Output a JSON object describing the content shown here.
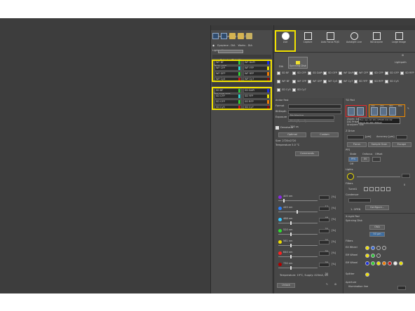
{
  "left_panel": {
    "title": "DC Fused (Spinning Disk) (1/2)",
    "section_lightpaths": "Lightpaths",
    "eyepiece": "Eyepiece - DIA",
    "works": "Works - DIA",
    "spinning_disk_label": "Spinning Disk (1)",
    "wf_section": "Wide Field",
    "sd_section": "Spinning Disc",
    "wf_rows": [
      {
        "left": "WF BF",
        "right": "WF DAPI",
        "lc": "#2fbf3a",
        "rc": "#1a2ee0"
      },
      {
        "left": "WF CFP",
        "right": "WF YFP",
        "lc": "#2fd0d0",
        "rc": "#e8e000"
      },
      {
        "left": "WF GFP",
        "right": "WF RFP",
        "lc": "#30d030",
        "rc": "#f07a00"
      },
      {
        "left": "WF Cy5",
        "right": "WF Cy7",
        "lc": "#c81818",
        "rc": "#8a0a0a"
      }
    ],
    "sd_rows": [
      {
        "left": "SD BF",
        "right": "SD DAPI",
        "lc": "#2fbf3a",
        "rc": "#1a2ee0"
      },
      {
        "left": "SD CFP",
        "right": "SD YFP",
        "lc": "#2fd0d0",
        "rc": "#e8e000"
      },
      {
        "left": "SD GFP",
        "right": "SD RFP",
        "lc": "#30d030",
        "rc": "#f07a00"
      },
      {
        "left": "SD Cy5",
        "right": "SD Cy7",
        "lc": "#c81818",
        "rc": "#8a0a0a"
      }
    ]
  },
  "right_panel": {
    "title": "Acquisition",
    "ribbon": [
      {
        "label": "Live",
        "icon": "play-icon"
      },
      {
        "label": "Capture",
        "icon": "camera-icon"
      },
      {
        "label": "Auto Focus PDJO",
        "icon": "autofocus-icon"
      },
      {
        "label": "Autolight Live",
        "icon": "sun-icon"
      },
      {
        "label": "ND Acquire",
        "icon": "nd-icon"
      },
      {
        "label": "Large Image",
        "icon": "grid-icon"
      }
    ],
    "lightpath_label": "Lightpath",
    "tabs": [
      {
        "label": "DIA"
      },
      {
        "label": "Spinning Disk"
      }
    ],
    "checks_row1": [
      "SD BF",
      "SD CFP",
      "SD DAPI",
      "SD GFP",
      "WF DAPI",
      "WF CFP",
      "SD CFP",
      "SD GFP",
      "SD RFP"
    ],
    "checks_row2": [
      "WF BF",
      "WF CFP",
      "WF GFP",
      "WF Cy5",
      "WF Cy7",
      "SD YFP",
      "SD RFP",
      "SD Cy5"
    ],
    "checks_row3": [
      "SD Cy5",
      "SD Cy7"
    ],
    "camera": {
      "header": "Andor Fast",
      "format_label": "Format",
      "format_value": "No binning",
      "bitdepth_label": "BitDepth",
      "bitdepth_value": "8 bit (Speed)",
      "exposure_label": "Exposure",
      "exposure_value": "700 us",
      "denoise_label": "Denoise.ai",
      "optimal": "Optimal",
      "custom": "Custom",
      "size_label": "Size: 2720x2720",
      "temp_label": "Temperature 5.0 °C",
      "commands": "Commands"
    },
    "lasers": [
      {
        "name": "405 nm",
        "value": "12",
        "unit": "[%]",
        "color": "#8a2be2",
        "level": 0.12
      },
      {
        "name": "445 nm",
        "value": "46",
        "unit": "[%]",
        "color": "#2a7fff",
        "level": 0.46
      },
      {
        "name": "488 nm",
        "value": "30",
        "unit": "[%]",
        "color": "#36c8ff",
        "level": 0.3
      },
      {
        "name": "520 nm",
        "value": "30",
        "unit": "[%]",
        "color": "#30e030",
        "level": 0.3
      },
      {
        "name": "561 nm",
        "value": "30",
        "unit": "[%]",
        "color": "#f0e000",
        "level": 0.3
      },
      {
        "name": "640 nm",
        "value": "30",
        "unit": "[%]",
        "color": "#ff2020",
        "level": 0.3
      },
      {
        "name": "730 nm",
        "value": "30",
        "unit": "[%]",
        "color": "#b00000",
        "level": 0.3
      }
    ],
    "laser_temp": "Temperature: 19°C, Supply: 420mA, SN",
    "unlock": "Unlock",
    "objective": {
      "header": "Ti2 Pad",
      "info_line1": "Zoom: 1x",
      "info_line2": "DIC Prism: -",
      "info_line3": "Analyzer: Out",
      "tooltip_line1": "Plan Apo λD 20x OFN25 DIC N2",
      "tooltip_line2": "NA=0.80 WD=800µm",
      "labels": [
        "10x",
        "20x",
        "40x",
        "60x"
      ]
    },
    "zdrive": {
      "header": "Z Drive",
      "value": "4094.380",
      "unit": "[µm]",
      "accuracy_label": "Accuracy [µm]",
      "accuracy_value": "0.000",
      "focus": "Focus",
      "sample_scan": "Sample Scan",
      "escape": "Escape"
    },
    "pfs": {
      "header": "PFS",
      "state": "State",
      "onfocus": "Onfocus",
      "offset": "Offset",
      "pfs_btn": "PFS",
      "in_btn": "IN",
      "off": "Off"
    },
    "lights": {
      "header": "Lights",
      "value": "0"
    },
    "filters": {
      "header": "Filters",
      "turret": "Turret1"
    },
    "condenser": {
      "header": "Condenser",
      "value": "1- OPEN",
      "config": "Configure..."
    },
    "xlight": {
      "header": "X-Light Pad",
      "sd_label": "Spinning Disk",
      "ona": "ONA",
      "pinhole": "50 µm"
    },
    "sd_filters": {
      "header": "Filters",
      "em_wheel": "EX Wheel",
      "em_wheel2": "EM Wheel",
      "em_wheel3": "EM Wheel",
      "splitter": "Splitter"
    },
    "aperture": {
      "header": "Aperture",
      "illum": "Illumination line",
      "value": "100"
    }
  }
}
